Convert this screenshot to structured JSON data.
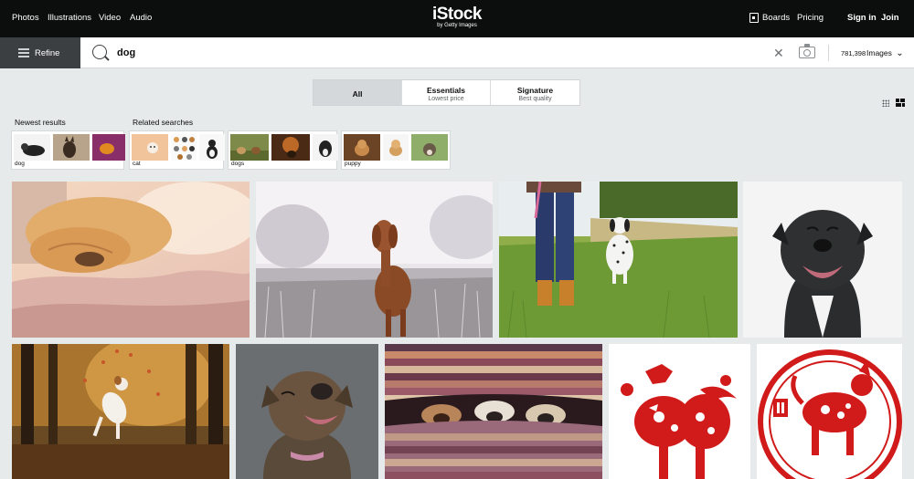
{
  "nav": {
    "photos": "Photos",
    "illustrations": "Illustrations",
    "video": "Video",
    "audio": "Audio",
    "boards": "Boards",
    "pricing": "Pricing",
    "sign_in": "Sign in",
    "join": "Join"
  },
  "logo": {
    "main": "iStock",
    "sub": "by Getty Images"
  },
  "refine": {
    "label": "Refine"
  },
  "search": {
    "value": "dog",
    "clear_icon": "close-icon",
    "camera_icon": "camera-icon"
  },
  "results": {
    "count": "781,398",
    "media_type": "Images",
    "chevron": "⌄"
  },
  "tabs": [
    {
      "label": "All",
      "sub": ""
    },
    {
      "label": "Essentials",
      "sub": "Lowest price"
    },
    {
      "label": "Signature",
      "sub": "Best quality"
    }
  ],
  "sections": {
    "newest": "Newest results",
    "related": "Related searches"
  },
  "related_cards": [
    {
      "label": "dog"
    },
    {
      "label": "cat"
    },
    {
      "label": "dogs"
    },
    {
      "label": "puppy"
    }
  ],
  "colors": {
    "topbar": "#0c0d0d",
    "refine": "#3b3f42",
    "background": "#e6eaeb",
    "papercut_red": "#d11a1a"
  }
}
